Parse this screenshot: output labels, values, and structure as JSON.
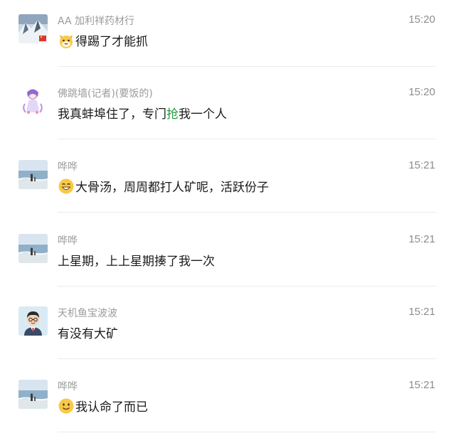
{
  "messages": [
    {
      "sender": "AA  加利祥药材行",
      "time": "15:20",
      "emoji": "cat-face-emoji",
      "text_pre": "得踢了才能抓",
      "text_hl": "",
      "text_post": "",
      "avatar": "snow-mountain-flag-avatar"
    },
    {
      "sender": "佛跳墙(记者)(要饭的)",
      "time": "15:20",
      "emoji": "",
      "text_pre": "我真蚌埠住了，专门",
      "text_hl": "抢",
      "text_post": "我一个人",
      "avatar": "anime-girl-avatar"
    },
    {
      "sender": "哗哗",
      "time": "15:21",
      "emoji": "grin-face-emoji",
      "text_pre": "大骨汤，周周都打人矿呢，活跃份子",
      "text_hl": "",
      "text_post": "",
      "avatar": "beach-photo-avatar"
    },
    {
      "sender": "哗哗",
      "time": "15:21",
      "emoji": "",
      "text_pre": "上星期，上上星期揍了我一次",
      "text_hl": "",
      "text_post": "",
      "avatar": "beach-photo-avatar"
    },
    {
      "sender": "天机鱼宝波波",
      "time": "15:21",
      "emoji": "",
      "text_pre": "有没有大矿",
      "text_hl": "",
      "text_post": "",
      "avatar": "cartoon-man-avatar"
    },
    {
      "sender": "哗哗",
      "time": "15:21",
      "emoji": "smile-face-emoji",
      "text_pre": "我认命了而已",
      "text_hl": "",
      "text_post": "",
      "avatar": "beach-photo-avatar"
    }
  ],
  "colors": {
    "highlight": "#1f9d3c",
    "sender": "#9b9b9b",
    "time": "#8d8d8d",
    "divider": "#ececec"
  }
}
